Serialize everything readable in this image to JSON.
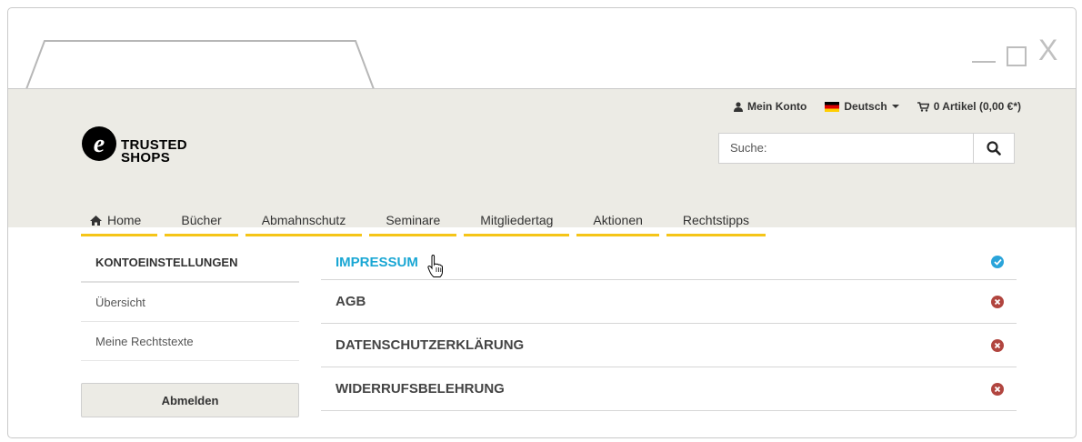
{
  "header": {
    "account_label": "Mein Konto",
    "language_label": "Deutsch",
    "cart_label": "0 Artikel (0,00 €*)",
    "search_placeholder": "Suche:",
    "logo_line1": "TRUSTED",
    "logo_line2": "SHOPS"
  },
  "nav": {
    "items": [
      "Home",
      "Bücher",
      "Abmahnschutz",
      "Seminare",
      "Mitgliedertag",
      "Aktionen",
      "Rechtstipps"
    ]
  },
  "sidebar": {
    "title": "KONTOEINSTELLUNGEN",
    "links": [
      "Übersicht",
      "Meine Rechtstexte"
    ],
    "logout_label": "Abmelden"
  },
  "content": {
    "rows": [
      {
        "label": "IMPRESSUM",
        "status": "ok"
      },
      {
        "label": "AGB",
        "status": "error"
      },
      {
        "label": "DATENSCHUTZERKLÄRUNG",
        "status": "error"
      },
      {
        "label": "WIDERRUFSBELEHRUNG",
        "status": "error"
      }
    ]
  },
  "colors": {
    "accent": "#1aa7d4",
    "nav_underline": "#f5c518",
    "error": "#b1453f",
    "header_bg": "#ecebe5"
  },
  "icons": {
    "account": "user-icon",
    "cart": "cart-icon",
    "search": "search-icon",
    "home": "home-icon",
    "ok": "check-circle-icon",
    "error": "x-circle-icon"
  }
}
